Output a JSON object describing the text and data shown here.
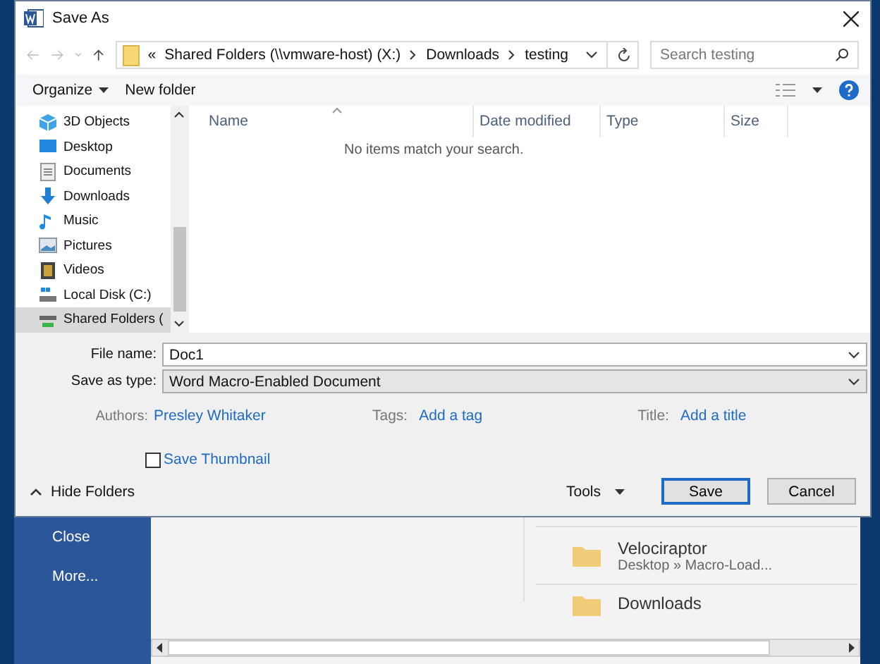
{
  "window": {
    "title": "Save As"
  },
  "address": {
    "crumbs": [
      "«",
      "Shared Folders (\\\\vmware-host) (X:)",
      "Downloads",
      "testing"
    ]
  },
  "search": {
    "placeholder": "Search testing"
  },
  "toolbar": {
    "organize": "Organize",
    "new_folder": "New folder"
  },
  "nav": {
    "items": [
      {
        "label": "3D Objects",
        "kind": "cube",
        "selected": false
      },
      {
        "label": "Desktop",
        "kind": "desktop",
        "selected": false
      },
      {
        "label": "Documents",
        "kind": "document",
        "selected": false
      },
      {
        "label": "Downloads",
        "kind": "download",
        "selected": false
      },
      {
        "label": "Music",
        "kind": "music",
        "selected": false
      },
      {
        "label": "Pictures",
        "kind": "pictures",
        "selected": false
      },
      {
        "label": "Videos",
        "kind": "videos",
        "selected": false
      },
      {
        "label": "Local Disk (C:)",
        "kind": "disk",
        "selected": false
      },
      {
        "label": "Shared Folders (",
        "kind": "share",
        "selected": true
      }
    ]
  },
  "table": {
    "columns": [
      "Name",
      "Date modified",
      "Type",
      "Size"
    ],
    "empty_message": "No items match your search."
  },
  "form": {
    "file_name_label": "File name:",
    "file_name": "Doc1",
    "type_label": "Save as type:",
    "type": "Word Macro-Enabled Document",
    "authors_label": "Authors:",
    "authors": "Presley Whitaker",
    "tags_label": "Tags:",
    "tags": "Add a tag",
    "title_label": "Title:",
    "title": "Add a title",
    "thumbnail": {
      "label": "Save Thumbnail",
      "checked": false
    }
  },
  "footer": {
    "hide_folders": "Hide Folders",
    "tools": "Tools",
    "buttons": [
      "Save",
      "Cancel"
    ]
  },
  "backstage": {
    "menu": [
      "Close",
      "More..."
    ],
    "recent": [
      {
        "name": "Velociraptor",
        "path": "Desktop » Macro-Load..."
      },
      {
        "name": "Downloads"
      }
    ]
  }
}
